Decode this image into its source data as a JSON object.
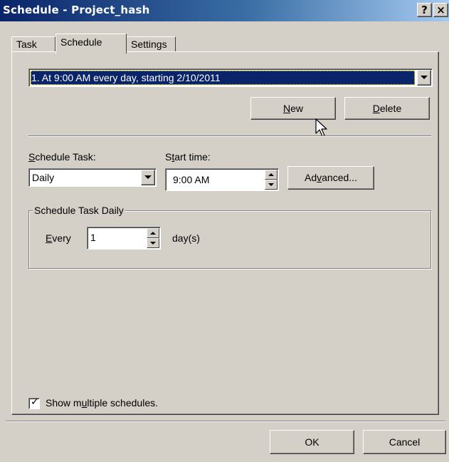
{
  "window": {
    "title": "Schedule - Project_hash",
    "help_label": "?",
    "close_label": "×"
  },
  "tabs": [
    {
      "label": "Task",
      "active": false
    },
    {
      "label": "Schedule",
      "active": true
    },
    {
      "label": "Settings",
      "active": false
    }
  ],
  "schedule_list": {
    "selected": "1. At 9:00 AM every day, starting 2/10/2011"
  },
  "buttons": {
    "new_pre": "",
    "new_key": "N",
    "new_post": "ew",
    "delete_pre": "",
    "delete_key": "D",
    "delete_post": "elete",
    "advanced_pre": "Ad",
    "advanced_key": "v",
    "advanced_post": "anced...",
    "ok": "OK",
    "cancel": "Cancel"
  },
  "schedule_task": {
    "label_key": "S",
    "label_post": "chedule Task:",
    "value": "Daily"
  },
  "start_time": {
    "label_pre": "S",
    "label_key": "t",
    "label_post": "art time:",
    "value": "9:00 AM"
  },
  "daily_group": {
    "legend": "Schedule Task Daily",
    "every_key": "E",
    "every_post": "very",
    "every_value": "1",
    "unit": "day(s)"
  },
  "show_multiple": {
    "checked": true,
    "label_pre": "Show m",
    "label_key": "u",
    "label_post": "ltiple schedules."
  },
  "colors": {
    "titlebar_start": "#0a246a",
    "titlebar_end": "#a6caf0",
    "face": "#d4d0c8",
    "selection": "#0a246a"
  }
}
